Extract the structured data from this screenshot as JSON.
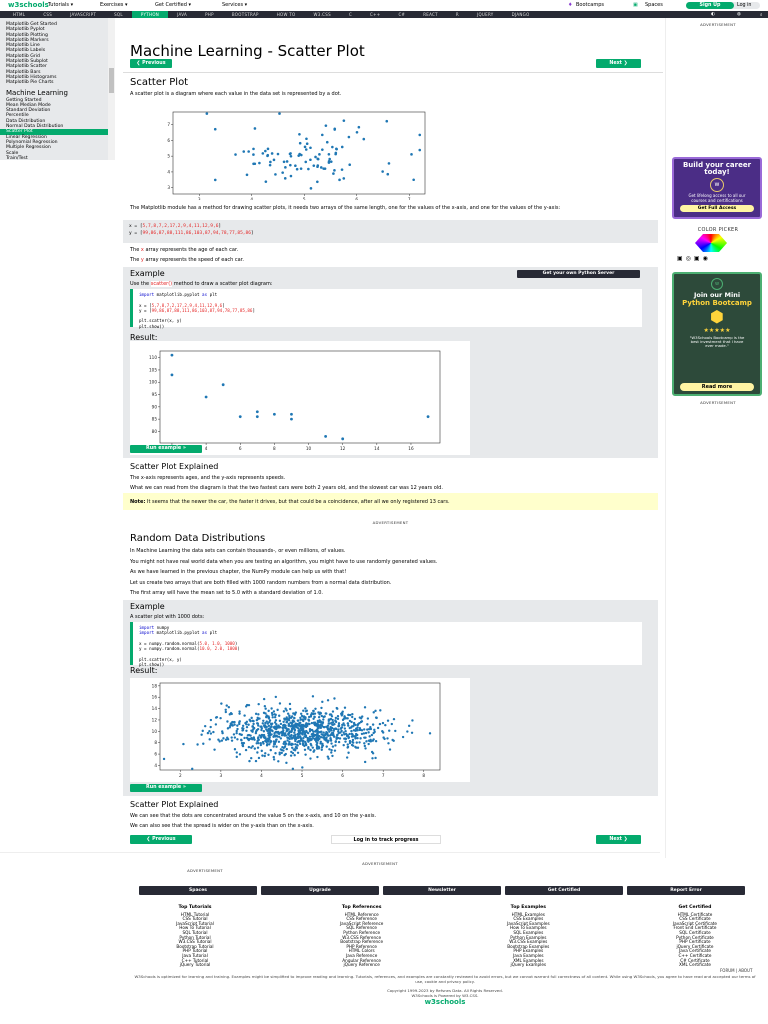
{
  "topbar": {
    "logo": "w3schools",
    "menus": [
      "Tutorials ▾",
      "Exercises ▾",
      "Get Certified ▾",
      "Services ▾"
    ],
    "bootcamps": "Bootcamps",
    "spaces": "Spaces",
    "signup": "Sign Up",
    "login": "Log in"
  },
  "nav": [
    "HTML",
    "CSS",
    "JAVASCRIPT",
    "SQL",
    "PYTHON",
    "JAVA",
    "PHP",
    "BOOTSTRAP",
    "HOW TO",
    "W3.CSS",
    "C",
    "C++",
    "C#",
    "REACT",
    "R",
    "JQUERY",
    "DJANGO"
  ],
  "sidebar": {
    "matplotlib": [
      "Matplotlib Get Started",
      "Matplotlib Pyplot",
      "Matplotlib Plotting",
      "Matplotlib Markers",
      "Matplotlib Line",
      "Matplotlib Labels",
      "Matplotlib Grid",
      "Matplotlib Subplot",
      "Matplotlib Scatter",
      "Matplotlib Bars",
      "Matplotlib Histograms",
      "Matplotlib Pie Charts"
    ],
    "heading": "Machine Learning",
    "ml": [
      "Getting Started",
      "Mean Median Mode",
      "Standard Deviation",
      "Percentile",
      "Data Distribution",
      "Normal Data Distribution",
      "Scatter Plot",
      "Linear Regression",
      "Polynomial Regression",
      "Multiple Regression",
      "Scale",
      "Train/Test"
    ]
  },
  "main": {
    "title": "Machine Learning - Scatter Plot",
    "prev": "❮ Previous",
    "next": "Next ❯",
    "s1": {
      "title": "Scatter Plot",
      "intro": "A scatter plot is a diagram where each value in the data set is represented by a dot.",
      "method": "The Matplotlib module has a method for drawing scatter plots, it needs two arrays of the same length, one for the values of the x-axis, and one for the values of the y-axis:",
      "x_pre": "x = [",
      "x_vals": "5,7,8,7,2,17,2,9,4,11,12,9,6",
      "y_pre": "y = [",
      "y_vals": "99,86,87,88,111,86,103,87,94,78,77,85,86",
      "close": "]",
      "xdesc": [
        "The ",
        "x",
        " array represents the age of each car."
      ],
      "ydesc": [
        "The ",
        "y",
        " array represents the speed of each car."
      ]
    },
    "ex1": {
      "title": "Example",
      "server": "Get your own Python Server",
      "use": [
        "Use the ",
        "scatter()",
        " method to draw a scatter plot diagram:"
      ],
      "code": {
        "import": "import",
        "mod": " matplotlib.pyplot ",
        "as": "as",
        " plt": " plt",
        "l3": "plt.scatter(x, y)",
        "l4": "plt.show()"
      },
      "result": "Result:",
      "run": "Run example »"
    },
    "exp1": {
      "title": "Scatter Plot Explained",
      "l1": "The x-axis represents ages, and the y-axis represents speeds.",
      "l2": "What we can read from the diagram is that the two fastest cars were both 2 years old, and the slowest car was 12 years old."
    },
    "note": {
      "label": "Note:",
      "text": " It seems that the newer the car, the faster it drives, but that could be a coincidence, after all we only registered 13 cars."
    },
    "ad": "ADVERTISEMENT",
    "s2": {
      "title": "Random Data Distributions",
      "lines": [
        "In Machine Learning the data sets can contain thousands-, or even millions, of values.",
        "You might not have real world data when you are testing an algorithm, you might have to use randomly generated values.",
        "As we have learned in the previous chapter, the NumPy module can help us with that!",
        "Let us create two arrays that are both filled with 1000 random numbers from a normal data distribution.",
        "The first array will have the mean set to 5.0 with a standard deviation of 1.0.",
        "The second array will have the mean set to 10.0 with a standard deviation of 2.0:"
      ]
    },
    "ex2": {
      "title": "Example",
      "desc": "A scatter plot with 1000 dots:",
      "l1mod": " numpy",
      "xl": "x = numpy.random.normal(",
      "xa": "5.0, 1.0, 1000",
      "yl": "y = numpy.random.normal(",
      "ya": "10.0, 2.0, 1000",
      "cl": ")",
      "result": "Result:",
      "run": "Run example »"
    },
    "exp2": {
      "title": "Scatter Plot Explained",
      "l1": "We can see that the dots are concentrated around the value 5 on the x-axis, and 10 on the y-axis.",
      "l2": "We can also see that the spread is wider on the y-axis than on the x-axis."
    },
    "track": "Log in to track progress"
  },
  "right": {
    "ad": "ADVERTISEMENT",
    "promo1": {
      "title": "Build your career today!",
      "text": "Get lifelong access to all our courses and certifications",
      "btn": "Get Full Access"
    },
    "colorpicker": "COLOR PICKER",
    "promo2": {
      "title1": "Join our Mini",
      "title2": "Python Bootcamp",
      "stars": "★★★★★",
      "quote": "\"W3Schools Bootcamp is the best investment that I have ever made.\"",
      "btn": "Read more"
    },
    "ad2": "ADVERTISEMENT"
  },
  "footer": {
    "buttons": [
      "Spaces",
      "Upgrade",
      "Newsletter",
      "Get Certified",
      "Report Error"
    ],
    "cols": [
      {
        "title": "Top Tutorials",
        "items": [
          "HTML Tutorial",
          "CSS Tutorial",
          "JavaScript Tutorial",
          "How To Tutorial",
          "SQL Tutorial",
          "Python Tutorial",
          "W3.CSS Tutorial",
          "Bootstrap Tutorial",
          "PHP Tutorial",
          "Java Tutorial",
          "C++ Tutorial",
          "jQuery Tutorial"
        ]
      },
      {
        "title": "Top References",
        "items": [
          "HTML Reference",
          "CSS Reference",
          "JavaScript Reference",
          "SQL Reference",
          "Python Reference",
          "W3.CSS Reference",
          "Bootstrap Reference",
          "PHP Reference",
          "HTML Colors",
          "Java Reference",
          "Angular Reference",
          "jQuery Reference"
        ]
      },
      {
        "title": "Top Examples",
        "items": [
          "HTML Examples",
          "CSS Examples",
          "JavaScript Examples",
          "How To Examples",
          "SQL Examples",
          "Python Examples",
          "W3.CSS Examples",
          "Bootstrap Examples",
          "PHP Examples",
          "Java Examples",
          "XML Examples",
          "jQuery Examples"
        ]
      },
      {
        "title": "Get Certified",
        "items": [
          "HTML Certificate",
          "CSS Certificate",
          "JavaScript Certificate",
          "Front End Certificate",
          "SQL Certificate",
          "Python Certificate",
          "PHP Certificate",
          "jQuery Certificate",
          "Java Certificate",
          "C++ Certificate",
          "C# Certificate",
          "XML Certificate"
        ]
      }
    ],
    "forum": "FORUM | ABOUT",
    "disclaimer": "W3Schools is optimized for learning and training. Examples might be simplified to improve reading and learning. Tutorials, references, and examples are constantly reviewed to avoid errors, but we cannot warrant full correctness of all content. While using W3Schools, you agree to have read and accepted our terms of use, cookie and privacy policy.",
    "copyright": "Copyright 1999-2023 by Refsnes Data. All Rights Reserved.",
    "powered": "W3Schools is Powered by W3.CSS."
  },
  "colors": {
    "green": "#04aa6d",
    "dark": "#282a35",
    "gray": "#e7e9eb",
    "note": "#ffffcc",
    "dot": "#1f77b4"
  },
  "chart_data": [
    {
      "type": "scatter",
      "description_of_data": "random normal sample",
      "n": 100,
      "x_mean": 5.0,
      "x_std": 1.0,
      "y_mean": 5.0,
      "y_std": 1.0,
      "xticks": [
        3,
        4,
        5,
        6,
        7
      ],
      "yticks": [
        3,
        4,
        5,
        6,
        7
      ],
      "xlim": [
        2.5,
        7.3
      ],
      "ylim": [
        2.6,
        7.8
      ]
    },
    {
      "type": "scatter",
      "x": [
        5,
        7,
        8,
        7,
        2,
        17,
        2,
        9,
        4,
        11,
        12,
        9,
        6
      ],
      "y": [
        99,
        86,
        87,
        88,
        111,
        86,
        103,
        87,
        94,
        78,
        77,
        85,
        86
      ],
      "xticks": [
        2,
        4,
        6,
        8,
        10,
        12,
        14,
        16
      ],
      "yticks": [
        80,
        85,
        90,
        95,
        100,
        105,
        110
      ],
      "xlim": [
        1.3,
        17.7
      ],
      "ylim": [
        75.3,
        112.7
      ]
    },
    {
      "type": "scatter",
      "n": 1000,
      "x_mean": 5.0,
      "x_std": 1.0,
      "y_mean": 10.0,
      "y_std": 2.0,
      "xticks": [
        2,
        3,
        4,
        5,
        6,
        7,
        8
      ],
      "yticks": [
        4,
        6,
        8,
        10,
        12,
        14,
        16,
        18
      ],
      "xlim": [
        1.5,
        8.4
      ],
      "ylim": [
        3.2,
        18.5
      ]
    }
  ]
}
